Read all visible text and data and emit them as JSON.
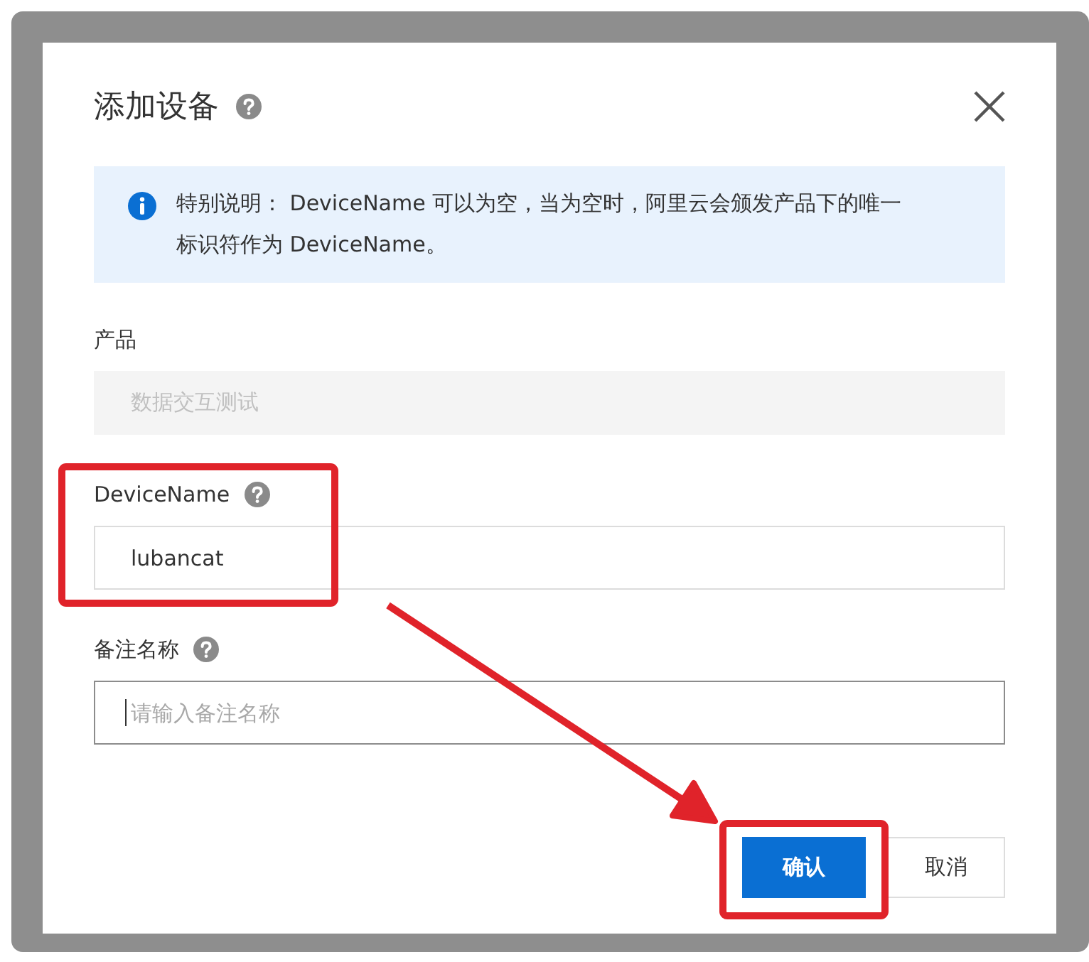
{
  "dialog": {
    "title": "添加设备",
    "notice": "特别说明： DeviceName 可以为空，当为空时，阿里云会颁发产品下的唯一标识符作为 DeviceName。",
    "fields": [
      {
        "label": "产品",
        "value": "数据交互测试",
        "disabled": true,
        "help": false,
        "focused": false
      },
      {
        "label": "DeviceName",
        "value": "lubancat",
        "disabled": false,
        "help": true,
        "focused": false
      },
      {
        "label": "备注名称",
        "placeholder": "请输入备注名称",
        "disabled": false,
        "help": true,
        "focused": true
      }
    ],
    "buttons": [
      {
        "label": "确认",
        "kind": "primary"
      },
      {
        "label": "取消",
        "kind": "secondary"
      }
    ]
  }
}
